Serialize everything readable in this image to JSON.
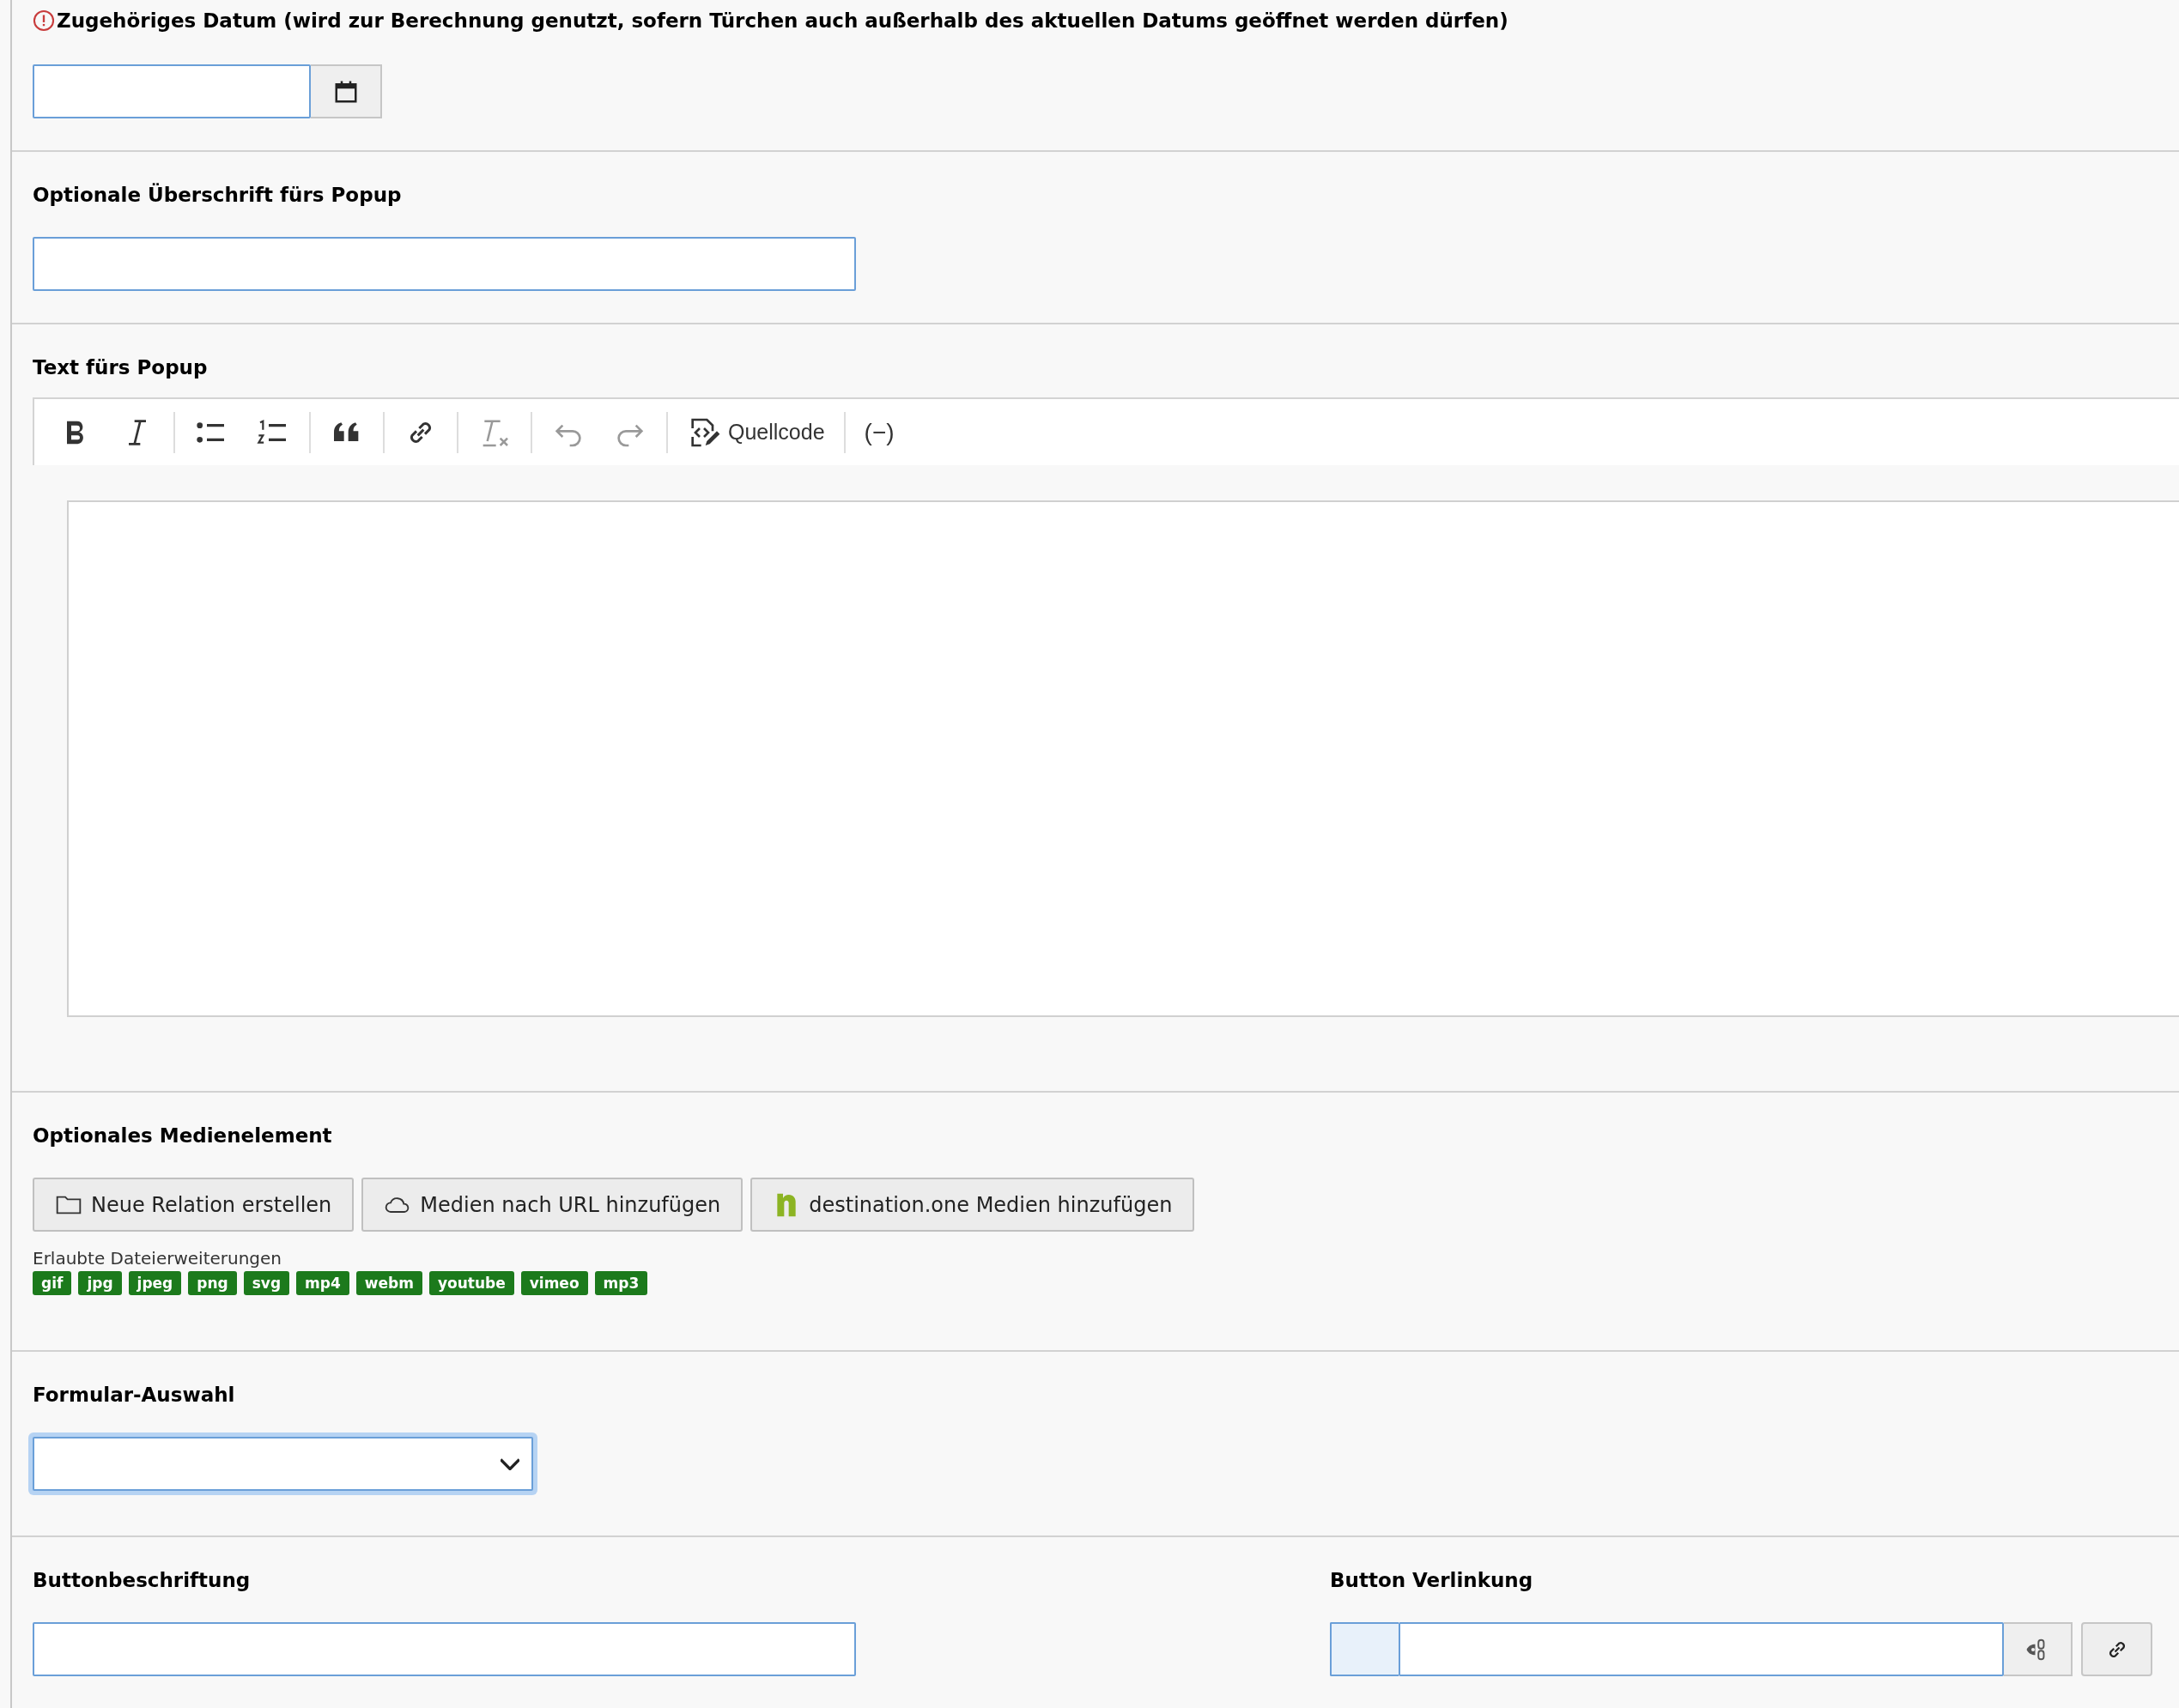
{
  "date_field": {
    "label": "Zugehöriges Datum (wird zur Berechnung genutzt, sofern Türchen auch außerhalb des aktuellen Datums geöffnet werden dürfen)",
    "required": true
  },
  "popup_heading": {
    "label": "Optionale Überschrift fürs Popup"
  },
  "popup_text": {
    "label": "Text fürs Popup",
    "toolbar": [
      {
        "kind": "bold",
        "disabled": false
      },
      {
        "kind": "italic",
        "disabled": false
      },
      {
        "kind": "separator"
      },
      {
        "kind": "bullets",
        "disabled": false
      },
      {
        "kind": "numbers",
        "disabled": false
      },
      {
        "kind": "separator"
      },
      {
        "kind": "quote",
        "disabled": false
      },
      {
        "kind": "separator"
      },
      {
        "kind": "link",
        "disabled": false
      },
      {
        "kind": "separator"
      },
      {
        "kind": "clear",
        "disabled": true
      },
      {
        "kind": "separator"
      },
      {
        "kind": "undo",
        "disabled": true
      },
      {
        "kind": "redo",
        "disabled": true
      },
      {
        "kind": "separator"
      },
      {
        "kind": "source",
        "label": "Quellcode",
        "disabled": false
      },
      {
        "kind": "separator"
      },
      {
        "kind": "text",
        "label": "(−)",
        "disabled": false
      }
    ]
  },
  "media": {
    "label": "Optionales Medienelement",
    "buttons": [
      {
        "kind": "folder",
        "label": "Neue Relation erstellen"
      },
      {
        "kind": "cloud",
        "label": "Medien nach URL hinzufügen"
      },
      {
        "kind": "brand",
        "label": "destination.one Medien hinzufügen"
      }
    ],
    "extensions_label": "Erlaubte Dateierweiterungen",
    "extensions": [
      "gif",
      "jpg",
      "jpeg",
      "png",
      "svg",
      "mp4",
      "webm",
      "youtube",
      "vimeo",
      "mp3"
    ]
  },
  "form_select": {
    "label": "Formular-Auswahl",
    "focused": true
  },
  "button_label": {
    "label": "Buttonbeschriftung"
  },
  "button_link": {
    "label": "Button Verlinkung"
  }
}
